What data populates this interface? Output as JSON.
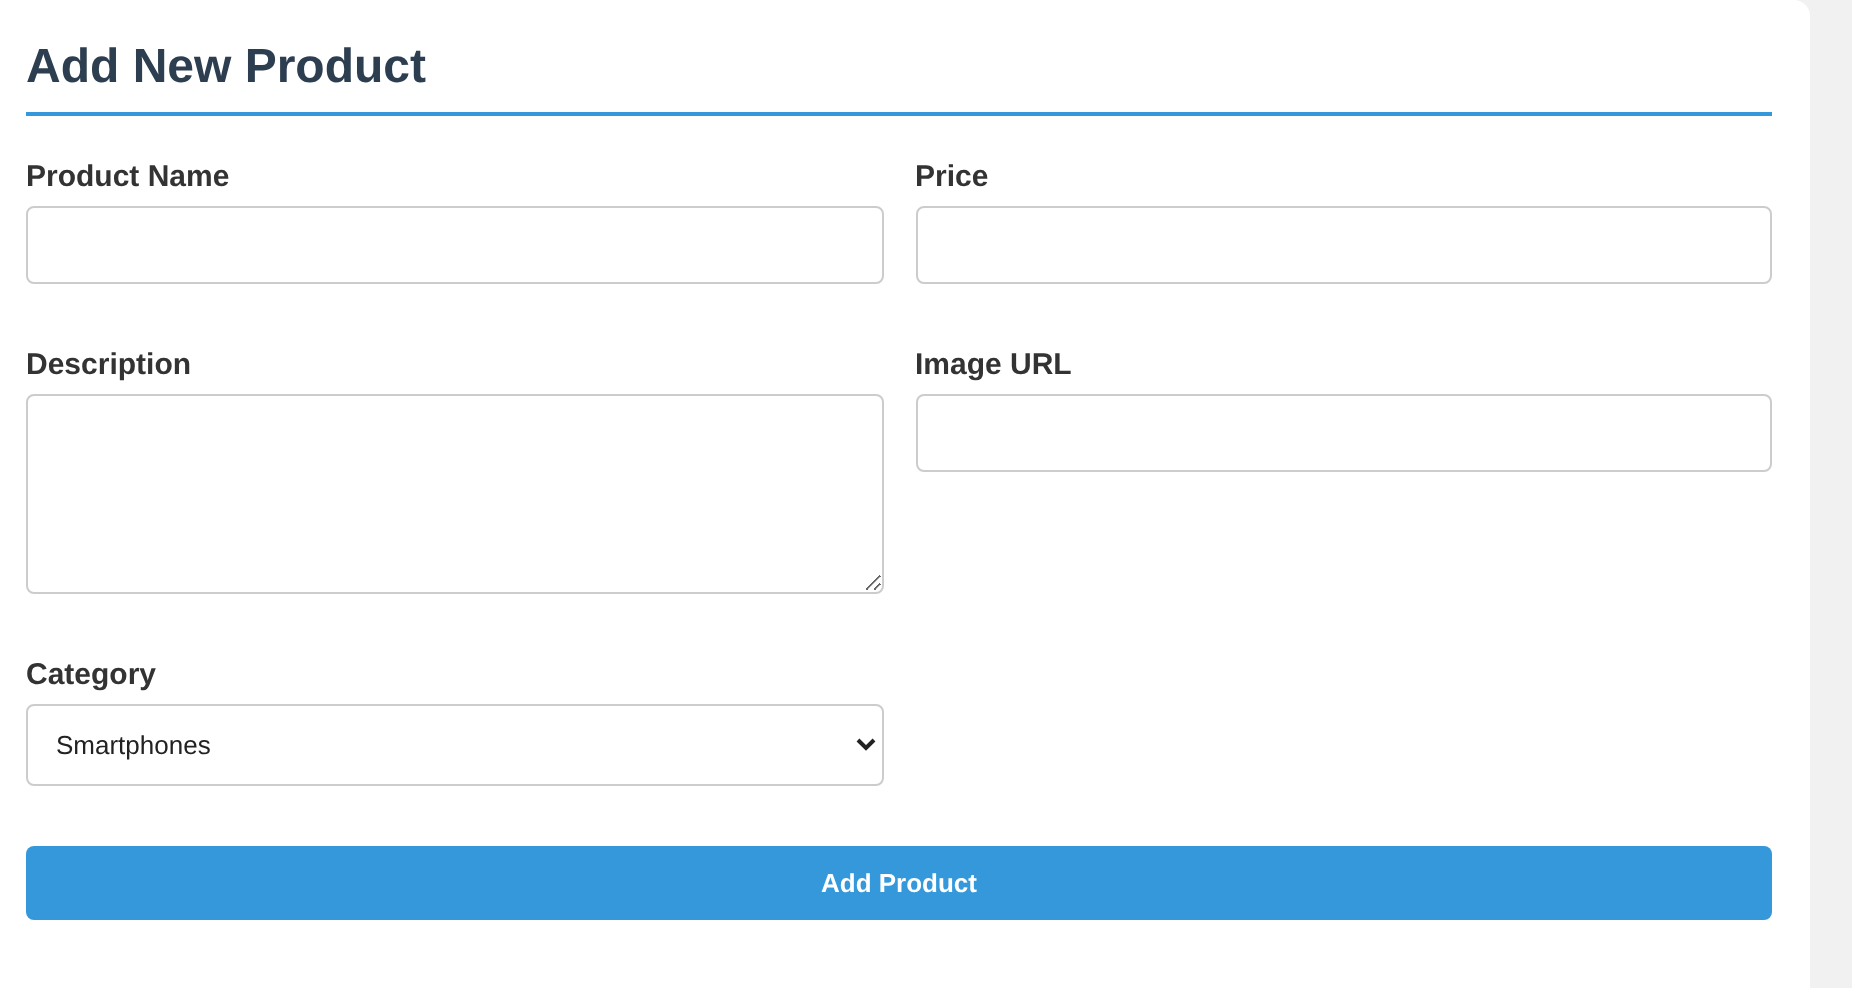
{
  "form": {
    "title": "Add New Product",
    "fields": [
      {
        "kind": "text",
        "label": "Product Name"
      },
      {
        "kind": "text",
        "label": "Price"
      },
      {
        "kind": "textarea",
        "label": "Description"
      },
      {
        "kind": "text",
        "label": "Image URL"
      },
      {
        "kind": "select",
        "label": "Category",
        "value": "Smartphones"
      }
    ],
    "submit": "Add Product"
  }
}
